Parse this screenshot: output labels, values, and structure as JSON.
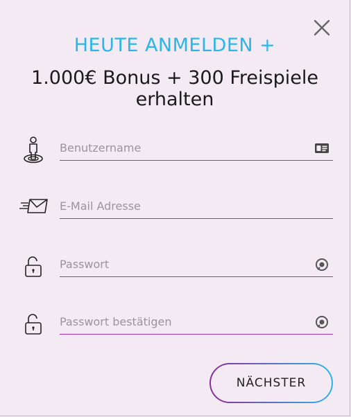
{
  "modal": {
    "headline": "HEUTE ANMELDEN +",
    "subline_1": "1.000€ Bonus + 300 Freispiele",
    "subline_2": "erhalten"
  },
  "form": {
    "username_placeholder": "Benutzername",
    "email_placeholder": "E-Mail Adresse",
    "password_placeholder": "Passwort",
    "password_confirm_placeholder": "Passwort bestätigen"
  },
  "buttons": {
    "next_label": "NÄCHSTER"
  },
  "icons": {
    "close": "close-icon",
    "user": "user-icon",
    "id_card": "id-card-icon",
    "email": "envelope-icon",
    "lock": "lock-icon",
    "show_password": "eye-icon"
  },
  "colors": {
    "accent_blue": "#2bb5e9",
    "accent_purple": "#a033a8",
    "background": "#f3eaf4"
  }
}
